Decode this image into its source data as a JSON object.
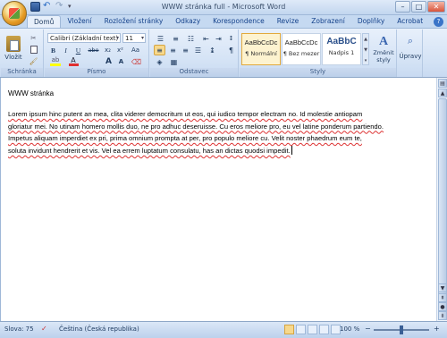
{
  "window": {
    "title": "WWW stránka full - Microsoft Word",
    "minimize": "–",
    "maximize": "□",
    "close": "✕"
  },
  "tabs": [
    "Domů",
    "Vložení",
    "Rozložení stránky",
    "Odkazy",
    "Korespondence",
    "Revize",
    "Zobrazení",
    "Doplňky",
    "Acrobat"
  ],
  "ribbon": {
    "clipboard": {
      "label": "Schránka",
      "paste": "Vložit"
    },
    "font": {
      "label": "Písmo",
      "family": "Calibri (Základní text)",
      "size": "11",
      "bold": "B",
      "italic": "I",
      "underline": "U",
      "strike": "abe",
      "sub": "x₂",
      "sup": "x²",
      "case": "Aa",
      "grow": "A",
      "shrink": "A"
    },
    "paragraph": {
      "label": "Odstavec"
    },
    "styles": {
      "label": "Styly",
      "items": [
        {
          "preview": "AaBbCcDc",
          "name": "¶ Normální"
        },
        {
          "preview": "AaBbCcDc",
          "name": "¶ Bez mezer"
        },
        {
          "preview": "AaBbC",
          "name": "Nadpis 1"
        }
      ],
      "change": "Změnit styly"
    },
    "editing": {
      "label": "Úpravy"
    }
  },
  "document": {
    "heading": "WWW stránka",
    "lines": [
      "Lorem ipsum hinc putent an mea, clita viderer democritum ut eos, qui iudico tempor electram no. Id molestie antiopam",
      "gloriatur mei. No utinam homero mollis duo, ne pro adhuc deseruisse. Cu eros meliore pro, eu vel latine ponderum partiendo.",
      "Impetus aliquam imperdiet ex pri, prima omnium prompta at per, pro populo meliore cu. Velit noster phaedrum eum te,",
      "soluta invidunt hendrerit et vis. Vel ea errem luptatum consulatu, has an dictas quodsi impedit."
    ]
  },
  "status": {
    "words": "Slova: 75",
    "language": "Čeština (Česká republika)",
    "zoom": "100 %",
    "zoom_out": "−",
    "zoom_in": "+"
  },
  "colors": {
    "accent": "#15428b",
    "ribbon": "#dbe7f7",
    "spell": "#d33",
    "highlight": "#ffff00",
    "font_color": "#e03030"
  }
}
